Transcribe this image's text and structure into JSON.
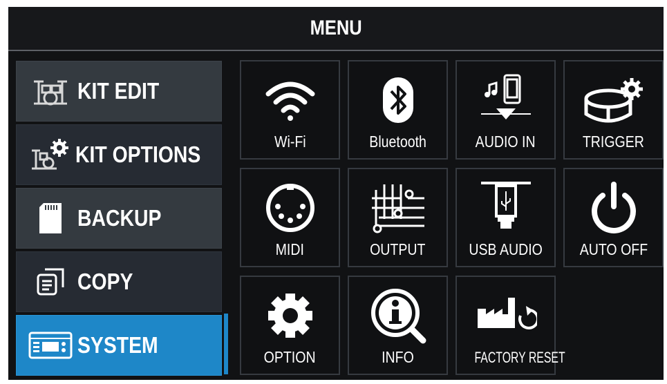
{
  "header": {
    "title": "MENU"
  },
  "sidebar": {
    "items": [
      {
        "label": "KIT EDIT",
        "icon": "drum-kit-icon"
      },
      {
        "label": "KIT OPTIONS",
        "icon": "drum-kit-gear-icon"
      },
      {
        "label": "BACKUP",
        "icon": "sd-card-icon"
      },
      {
        "label": "COPY",
        "icon": "copy-icon"
      },
      {
        "label": "SYSTEM",
        "icon": "system-device-icon",
        "selected": true
      }
    ]
  },
  "grid": {
    "tiles": [
      {
        "label": "Wi-Fi",
        "icon": "wifi-icon"
      },
      {
        "label": "Bluetooth",
        "icon": "bluetooth-icon"
      },
      {
        "label": "AUDIO IN",
        "icon": "audio-in-icon"
      },
      {
        "label": "TRIGGER",
        "icon": "trigger-icon"
      },
      {
        "label": "MIDI",
        "icon": "midi-icon"
      },
      {
        "label": "OUTPUT",
        "icon": "output-icon"
      },
      {
        "label": "USB AUDIO",
        "icon": "usb-audio-icon"
      },
      {
        "label": "AUTO OFF",
        "icon": "power-icon"
      },
      {
        "label": "OPTION",
        "icon": "gear-icon"
      },
      {
        "label": "INFO",
        "icon": "info-icon"
      },
      {
        "label": "FACTORY RESET",
        "icon": "factory-reset-icon"
      }
    ]
  },
  "colors": {
    "accent": "#1e87c8",
    "background": "#111214",
    "tile_border": "#363a40"
  }
}
